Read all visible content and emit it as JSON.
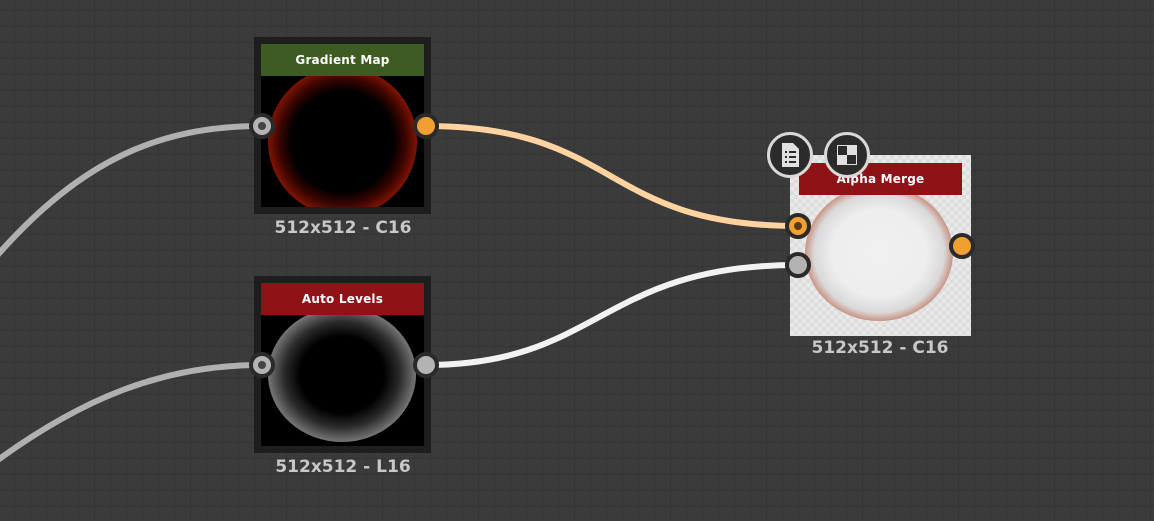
{
  "nodes": {
    "gradient_map": {
      "title": "Gradient Map",
      "caption": "512x512 - C16",
      "header_color": "#3e5c22"
    },
    "auto_levels": {
      "title": "Auto Levels",
      "caption": "512x512 - L16",
      "header_color": "#8e1216"
    },
    "alpha_merge": {
      "title": "Alpha Merge",
      "caption": "512x512 - C16",
      "header_color": "#8e1216"
    }
  },
  "toolbar": {
    "icons": [
      "document-list-icon",
      "checker-icon"
    ]
  },
  "colors": {
    "background": "#3b3b3b",
    "wire_gray": "#b0b0b0",
    "wire_white": "#f2f2f2",
    "wire_orange": "#ffd3a0",
    "port_orange": "#f0a030",
    "port_gray": "#b3b3b3"
  }
}
